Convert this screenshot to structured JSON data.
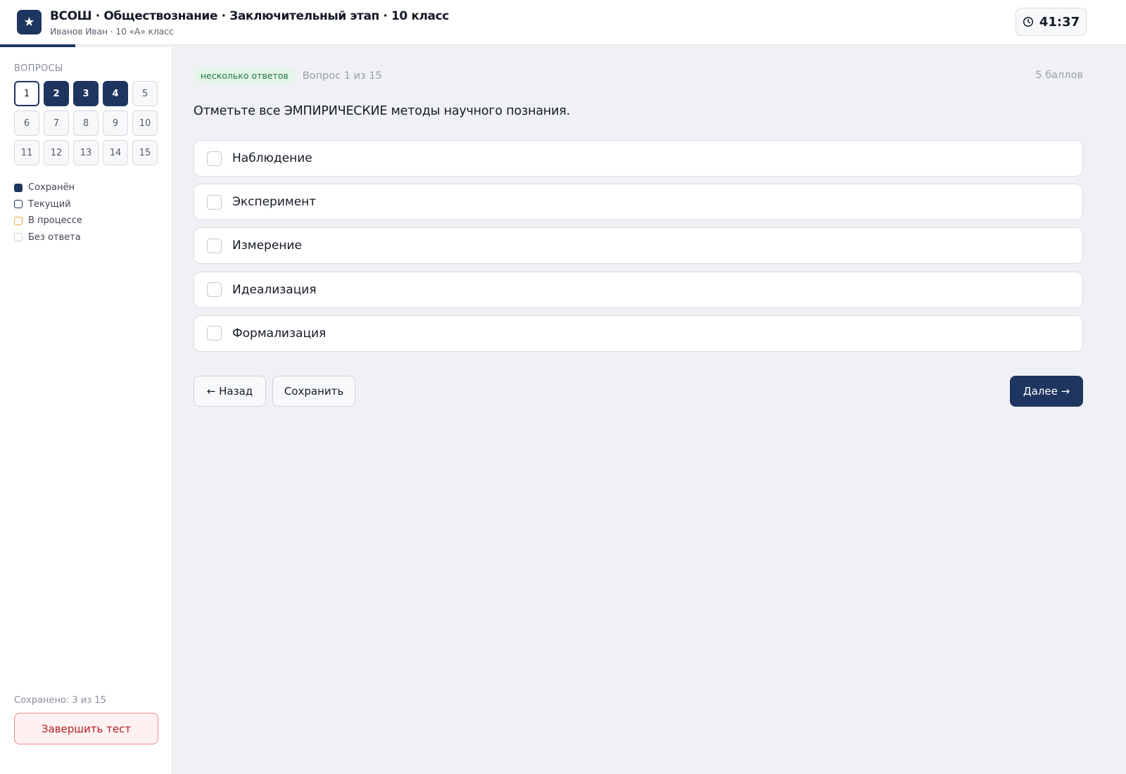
{
  "header": {
    "logo_glyph": "★",
    "title": "ВСОШ · Обществознание · Заключительный этап · 10 класс",
    "subtitle": "Иванов Иван · 10 «А» класс",
    "timer": "41:37",
    "timer_icon": "clock-icon",
    "progress_fraction": 0.0667
  },
  "sidebar": {
    "heading": "ВОПРОСЫ",
    "questions": [
      {
        "label": "1",
        "state": "current"
      },
      {
        "label": "2",
        "state": "saved"
      },
      {
        "label": "3",
        "state": "saved"
      },
      {
        "label": "4",
        "state": "saved"
      },
      {
        "label": "5",
        "state": "unanswered"
      },
      {
        "label": "6",
        "state": "unanswered"
      },
      {
        "label": "7",
        "state": "unanswered"
      },
      {
        "label": "8",
        "state": "unanswered"
      },
      {
        "label": "9",
        "state": "unanswered"
      },
      {
        "label": "10",
        "state": "unanswered"
      },
      {
        "label": "11",
        "state": "unanswered"
      },
      {
        "label": "12",
        "state": "unanswered"
      },
      {
        "label": "13",
        "state": "unanswered"
      },
      {
        "label": "14",
        "state": "unanswered"
      },
      {
        "label": "15",
        "state": "unanswered"
      }
    ],
    "legend": [
      {
        "label": "Сохранён"
      },
      {
        "label": "Текущий"
      },
      {
        "label": "В процессе"
      },
      {
        "label": "Без ответа"
      }
    ],
    "saved_count": "Сохранено: 3 из 15",
    "finish_label": "Завершить тест"
  },
  "main": {
    "badge": "несколько ответов",
    "question_number": "Вопрос 1 из 15",
    "points": "5 баллов",
    "question_text": "Отметьте все ЭМПИРИЧЕСКИЕ методы научного познания.",
    "options": [
      {
        "label": "Наблюдение",
        "checked": false
      },
      {
        "label": "Эксперимент",
        "checked": false
      },
      {
        "label": "Измерение",
        "checked": false
      },
      {
        "label": "Идеализация",
        "checked": false
      },
      {
        "label": "Формализация",
        "checked": false
      }
    ],
    "back_label": "← Назад",
    "save_label": "Сохранить",
    "next_label": "Далее →"
  },
  "colors": {
    "accent": "#1e3560",
    "badge_bg": "#e5f4e9",
    "badge_text": "#1d7a3e",
    "in_progress": "#e8a53a",
    "danger": "#b21f1f"
  }
}
